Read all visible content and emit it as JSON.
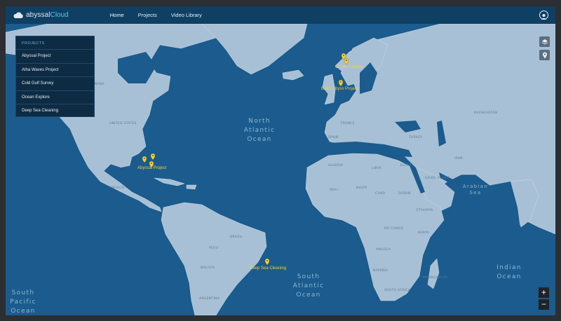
{
  "brand": {
    "part1": "abyssal",
    "part2": "Cloud"
  },
  "nav": {
    "items": [
      "Home",
      "Projects",
      "Video Library"
    ]
  },
  "panel": {
    "title": "PROJECTS",
    "items": [
      "Abyssal Project",
      "Atha Waves Project",
      "Cold Gulf Survey",
      "Ocean Explore",
      "Deep Sea Cleaning"
    ]
  },
  "map": {
    "ocean_labels": {
      "north_atlantic": "North\nAtlantic\nOcean",
      "south_atlantic": "South\nAtlantic\nOcean",
      "south_pacific": "South\nPacific\nOcean",
      "indian": "Indian\nOcean",
      "arabian_sea": "Arabian\nSea"
    },
    "markers": {
      "abyssal": "Abyssal Project",
      "ocean_explore": "Ocean Explore",
      "baltic": "Baltic Abyss Project",
      "deep_sea": "Deep Sea Cleaning"
    },
    "land_labels": {
      "us": "UNITED STATES",
      "canada": "CANADA",
      "mexico": "MEXICO",
      "brazil": "BRAZIL",
      "algeria": "ALGERIA",
      "libya": "LIBYA",
      "egypt": "EGYPT",
      "mali": "MALI",
      "niger": "NIGER",
      "chad": "CHAD",
      "sudan": "SUDAN",
      "ethiopia": "ETHIOPIA",
      "saudi": "SAUDI ARABIA",
      "iran": "IRAN",
      "kazakhstan": "KAZAKHSTAN",
      "turkey": "TURKEY",
      "spain": "SPAIN",
      "france": "FRANCE",
      "peru": "PERU",
      "bolivia": "BOLIVIA",
      "argentina": "ARGENTINA",
      "angola": "ANGOLA",
      "namibia": "NAMIBIA",
      "south_africa": "SOUTH AFRICA",
      "madagascar": "MADAGASCAR",
      "kenya": "KENYA",
      "dr_congo": "DR CONGO"
    }
  },
  "controls": {
    "zoom_in": "+",
    "zoom_out": "−"
  },
  "colors": {
    "accent": "#52c6f3",
    "marker": "#f4d13c",
    "ocean": "#1a5a8c",
    "land": "#a9c1d6"
  }
}
